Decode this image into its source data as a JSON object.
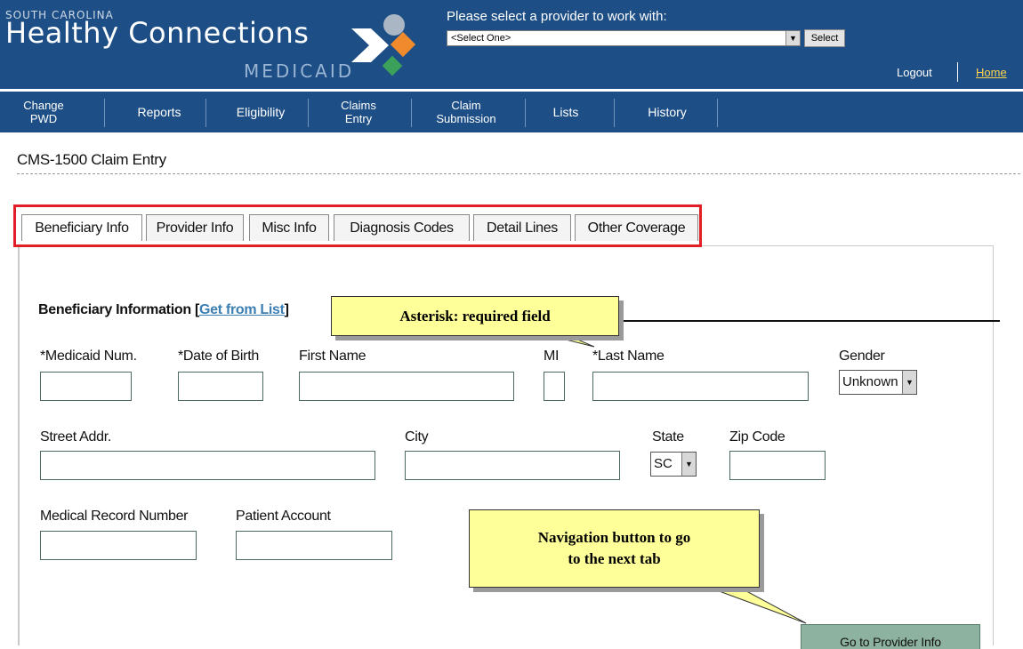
{
  "header": {
    "state_label": "SOUTH CAROLINA",
    "brand_title": "Healthy Connections",
    "brand_sub": "MEDICAID",
    "provider_label": "Please select a provider to work with:",
    "provider_select_value": "<Select One>",
    "select_button": "Select",
    "logout": "Logout",
    "home": "Home",
    "logo_icon": "healthy-connections-logo",
    "colors": {
      "header_bg": "#1d4f86",
      "home_link": "#ffd34d"
    }
  },
  "nav": [
    {
      "line1": "Change",
      "line2": "PWD"
    },
    {
      "line1": "Reports",
      "line2": ""
    },
    {
      "line1": "Eligibility",
      "line2": ""
    },
    {
      "line1": "Claims",
      "line2": "Entry"
    },
    {
      "line1": "Claim",
      "line2": "Submission"
    },
    {
      "line1": "Lists",
      "line2": ""
    },
    {
      "line1": "History",
      "line2": ""
    }
  ],
  "page": {
    "title": "CMS-1500 Claim Entry",
    "tabs": [
      "Beneficiary Info",
      "Provider Info",
      "Misc Info",
      "Diagnosis Codes",
      "Detail Lines",
      "Other Coverage"
    ],
    "active_tab": "Beneficiary Info",
    "tab_highlight_color": "#e21f26"
  },
  "section": {
    "title": "Beneficiary Information",
    "bracket_open": "[",
    "link": "Get from List",
    "bracket_close": "]"
  },
  "fields": {
    "medicaid_num": "*Medicaid Num.",
    "dob": "*Date of Birth",
    "first_name": "First Name",
    "mi": "MI",
    "last_name": "*Last Name",
    "gender": "Gender",
    "gender_value": "Unknown",
    "street": "Street Addr.",
    "city": "City",
    "state": "State",
    "state_value": "SC",
    "zip": "Zip Code",
    "mrn": "Medical Record Number",
    "patient_account": "Patient Account"
  },
  "callouts": {
    "required": "Asterisk: required field",
    "nav_line1": "Navigation button to go",
    "nav_line2": "to the next tab"
  },
  "buttons": {
    "go_provider": "Go to Provider Info"
  }
}
